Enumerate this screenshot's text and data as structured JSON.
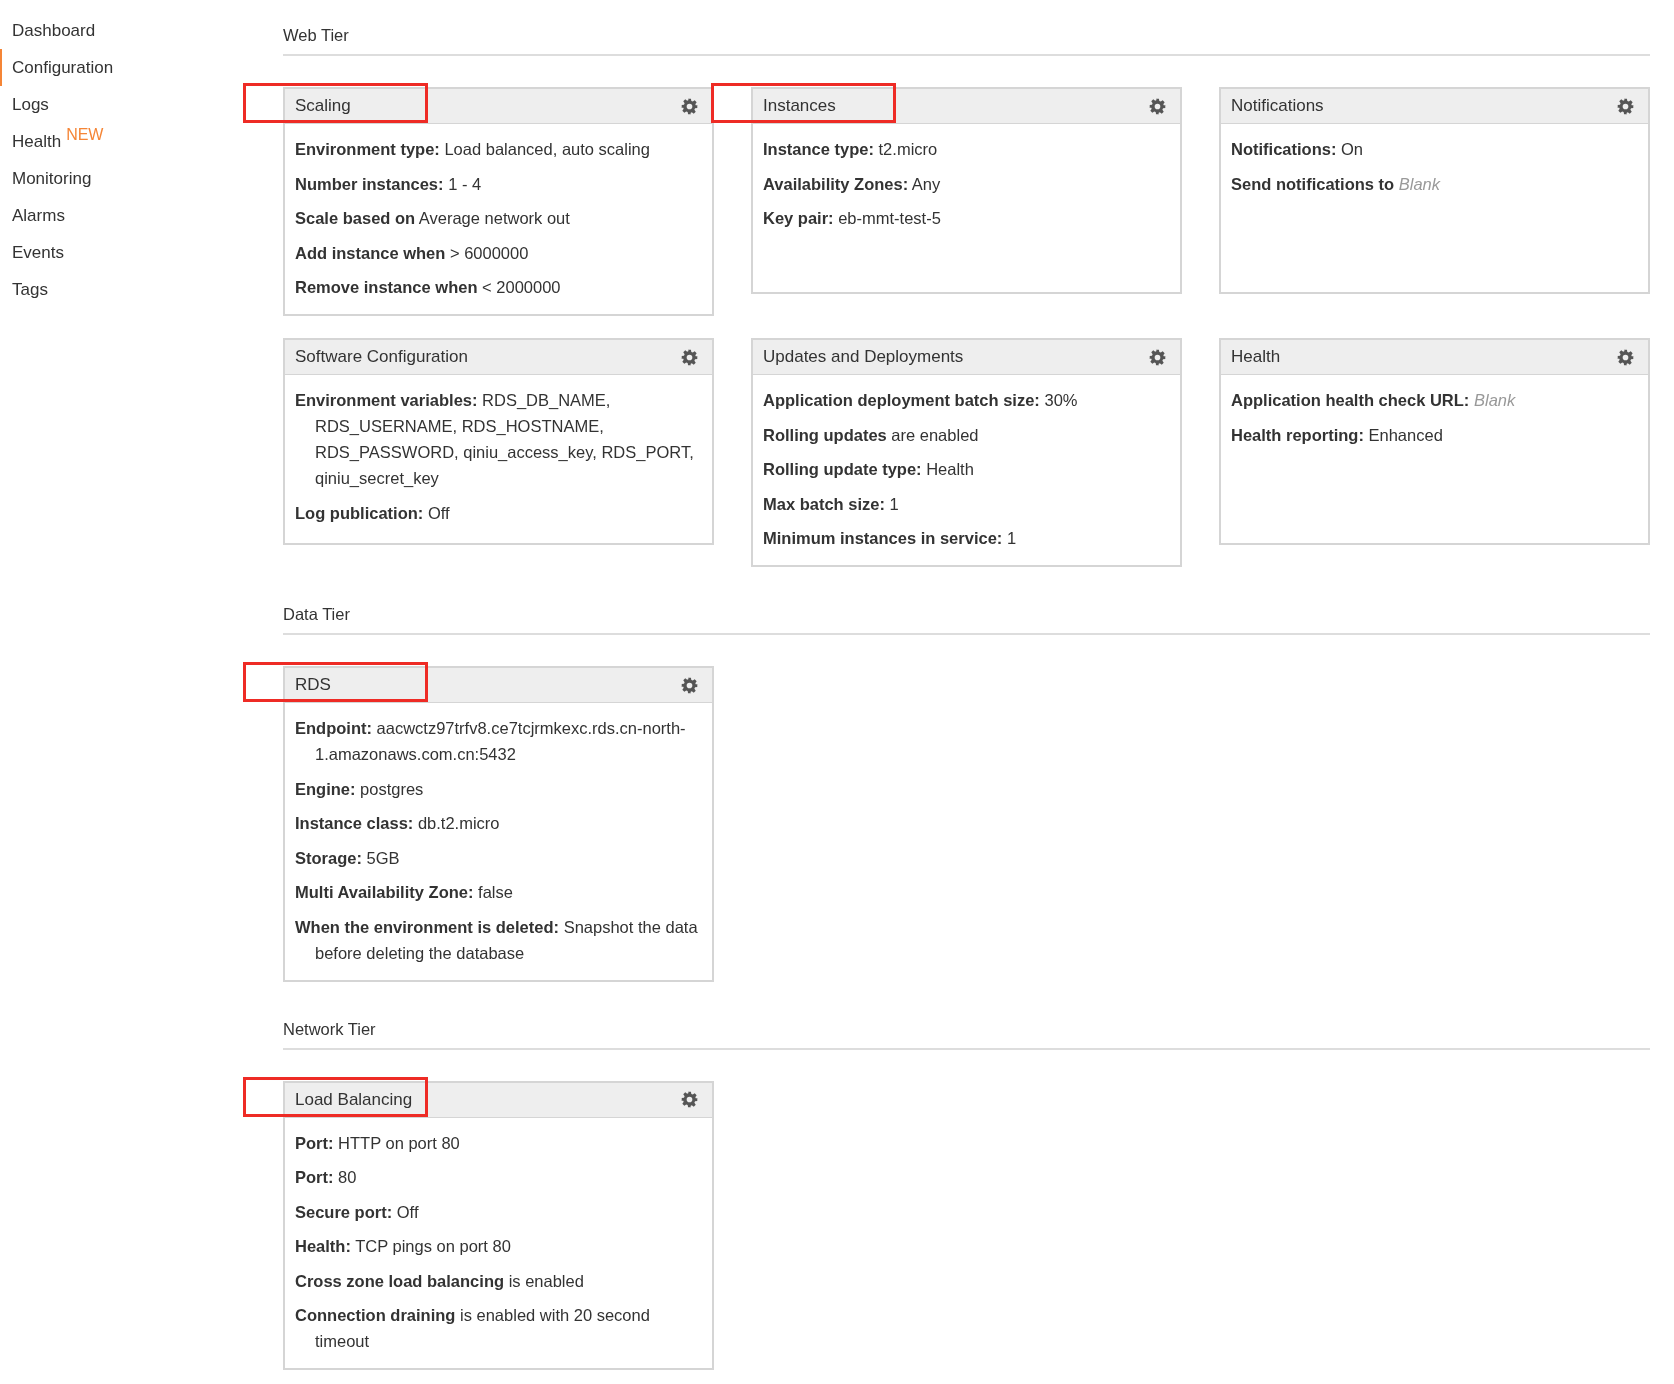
{
  "sidebar": {
    "items": [
      {
        "label": "Dashboard",
        "selected": false
      },
      {
        "label": "Configuration",
        "selected": true
      },
      {
        "label": "Logs",
        "selected": false
      },
      {
        "label": "Health",
        "selected": false,
        "badge": "NEW"
      },
      {
        "label": "Monitoring",
        "selected": false
      },
      {
        "label": "Alarms",
        "selected": false
      },
      {
        "label": "Events",
        "selected": false
      },
      {
        "label": "Tags",
        "selected": false
      }
    ]
  },
  "sections": [
    {
      "title": "Web Tier",
      "cards": [
        {
          "title": "Scaling",
          "highlighted": true,
          "rows": [
            "**Environment type:** Load balanced, auto scaling",
            "**Number instances:** 1 - 4",
            "**Scale based on** Average network out",
            "**Add instance when** > 6000000",
            "**Remove instance when** < 2000000"
          ]
        },
        {
          "title": "Instances",
          "highlighted": true,
          "rows": [
            "**Instance type:** t2.micro",
            "**Availability Zones:** Any",
            "**Key pair:** eb-mmt-test-5"
          ]
        },
        {
          "title": "Notifications",
          "highlighted": false,
          "rows": [
            "**Notifications:** On",
            "**Send notifications to** *Blank*"
          ]
        },
        {
          "title": "Software Configuration",
          "highlighted": false,
          "rows": [
            "**Environment variables:** RDS_DB_NAME, RDS_USERNAME, RDS_HOSTNAME, RDS_PASSWORD, qiniu_access_key, RDS_PORT, qiniu_secret_key",
            "**Log publication:** Off"
          ]
        },
        {
          "title": "Updates and Deployments",
          "highlighted": false,
          "rows": [
            "**Application deployment batch size:** 30%",
            "**Rolling updates** are enabled",
            "**Rolling update type:** Health",
            "**Max batch size:** 1",
            "**Minimum instances in service:** 1"
          ]
        },
        {
          "title": "Health",
          "highlighted": false,
          "rows": [
            "**Application health check URL:** *Blank*",
            "**Health reporting:** Enhanced"
          ]
        }
      ]
    },
    {
      "title": "Data Tier",
      "cards": [
        {
          "title": "RDS",
          "highlighted": true,
          "rows": [
            "**Endpoint:** aacwctz97trfv8.ce7tcjrmkexc.rds.cn-north-1.amazonaws.com.cn:5432",
            "**Engine:** postgres",
            "**Instance class:** db.t2.micro",
            "**Storage:** 5GB",
            "**Multi Availability Zone:** false",
            "**When the environment is deleted:** Snapshot the data before deleting the database"
          ]
        }
      ]
    },
    {
      "title": "Network Tier",
      "cards": [
        {
          "title": "Load Balancing",
          "highlighted": true,
          "rows": [
            "**Port:** HTTP on port 80",
            "**Port:** 80",
            "**Secure port:** Off",
            "**Health:** TCP pings on port 80",
            "**Cross zone load balancing** is enabled",
            "**Connection draining** is enabled with 20 second timeout"
          ]
        }
      ]
    }
  ]
}
